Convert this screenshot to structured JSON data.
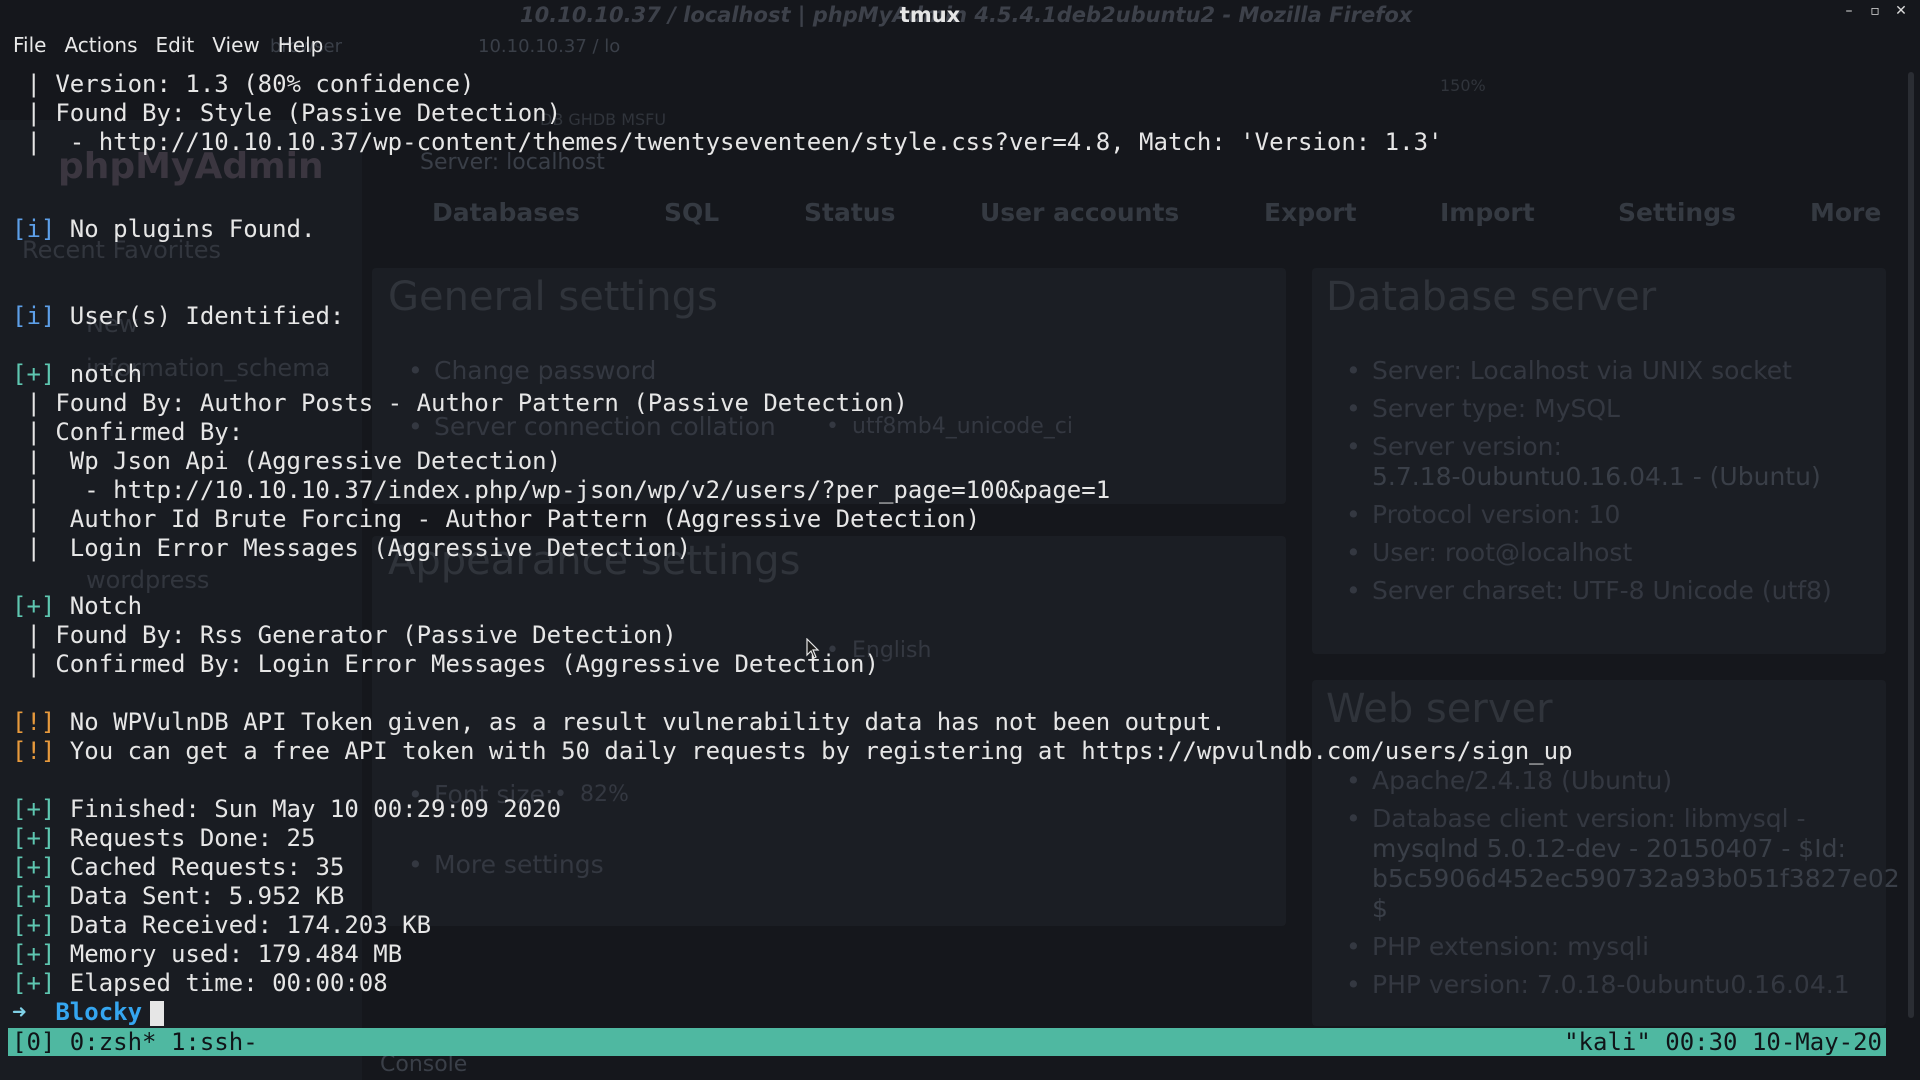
{
  "window": {
    "title": "tmux",
    "background_title": "10.10.10.37 / localhost | phpMyAdmin 4.5.4.1deb2ubuntu2 - Mozilla Firefox"
  },
  "menu": [
    "File",
    "Actions",
    "Edit",
    "View",
    "Help"
  ],
  "background": {
    "tabs": [
      "browser",
      "10.10.10.37 / lo"
    ],
    "bookmarks": "DB  GHDB  MSFU",
    "zoom": "150%",
    "logo": "phpMyAdmin",
    "breadcrumb": "Server: localhost",
    "nav_tabs": [
      "Databases",
      "SQL",
      "Status",
      "User accounts",
      "Export",
      "Import",
      "Settings",
      "More"
    ],
    "sidebar": [
      "Recent  Favorites",
      "New",
      "information_schema",
      "wordpress"
    ],
    "general_settings": "General settings",
    "change_password": "Change password",
    "server_collation_label": "Server connection collation",
    "server_collation_value": "utf8mb4_unicode_ci",
    "appearance_settings": "Appearance settings",
    "language_value": "English",
    "font_size_label": "Font size:",
    "font_size_value": "82%",
    "more_settings": "More settings",
    "database_server_title": "Database server",
    "database_server": [
      "Server: Localhost via UNIX socket",
      "Server type: MySQL",
      "Server version:",
      "5.7.18-0ubuntu0.16.04.1 - (Ubuntu)",
      "Protocol version: 10",
      "User: root@localhost",
      "Server charset: UTF-8 Unicode (utf8)"
    ],
    "web_server_title": "Web server",
    "web_server": [
      "Apache/2.4.18 (Ubuntu)",
      "Database client version: libmysql -",
      "mysqlnd 5.0.12-dev - 20150407 - $Id:",
      "b5c5906d452ec590732a93b051f3827e02",
      "$",
      "PHP extension: mysqli",
      "PHP version: 7.0.18-0ubuntu0.16.04.1"
    ],
    "console": "Console"
  },
  "terminal": {
    "lines": [
      {
        "prefix": "",
        "text": " | Version: 1.3 (80% confidence)"
      },
      {
        "prefix": "",
        "text": " | Found By: Style (Passive Detection)"
      },
      {
        "prefix": "",
        "text": " |  - http://10.10.10.37/wp-content/themes/twentyseventeen/style.css?ver=4.8, Match: 'Version: 1.3'"
      },
      {
        "prefix": "",
        "text": ""
      },
      {
        "prefix": "",
        "text": ""
      },
      {
        "prefix": "[i]",
        "kind": "info",
        "text": " No plugins Found."
      },
      {
        "prefix": "",
        "text": ""
      },
      {
        "prefix": "",
        "text": ""
      },
      {
        "prefix": "[i]",
        "kind": "info",
        "text": " User(s) Identified:"
      },
      {
        "prefix": "",
        "text": ""
      },
      {
        "prefix": "[+]",
        "kind": "plus",
        "text": " notch"
      },
      {
        "prefix": "",
        "text": " | Found By: Author Posts - Author Pattern (Passive Detection)"
      },
      {
        "prefix": "",
        "text": " | Confirmed By:"
      },
      {
        "prefix": "",
        "text": " |  Wp Json Api (Aggressive Detection)"
      },
      {
        "prefix": "",
        "text": " |   - http://10.10.10.37/index.php/wp-json/wp/v2/users/?per_page=100&page=1"
      },
      {
        "prefix": "",
        "text": " |  Author Id Brute Forcing - Author Pattern (Aggressive Detection)"
      },
      {
        "prefix": "",
        "text": " |  Login Error Messages (Aggressive Detection)"
      },
      {
        "prefix": "",
        "text": ""
      },
      {
        "prefix": "[+]",
        "kind": "plus",
        "text": " Notch"
      },
      {
        "prefix": "",
        "text": " | Found By: Rss Generator (Passive Detection)"
      },
      {
        "prefix": "",
        "text": " | Confirmed By: Login Error Messages (Aggressive Detection)"
      },
      {
        "prefix": "",
        "text": ""
      },
      {
        "prefix": "[!]",
        "kind": "warn",
        "text": " No WPVulnDB API Token given, as a result vulnerability data has not been output."
      },
      {
        "prefix": "[!]",
        "kind": "warn",
        "text": " You can get a free API token with 50 daily requests by registering at https://wpvulndb.com/users/sign_up"
      },
      {
        "prefix": "",
        "text": ""
      },
      {
        "prefix": "[+]",
        "kind": "plus",
        "text": " Finished: Sun May 10 00:29:09 2020"
      },
      {
        "prefix": "[+]",
        "kind": "plus",
        "text": " Requests Done: 25"
      },
      {
        "prefix": "[+]",
        "kind": "plus",
        "text": " Cached Requests: 35"
      },
      {
        "prefix": "[+]",
        "kind": "plus",
        "text": " Data Sent: 5.952 KB"
      },
      {
        "prefix": "[+]",
        "kind": "plus",
        "text": " Data Received: 174.203 KB"
      },
      {
        "prefix": "[+]",
        "kind": "plus",
        "text": " Memory used: 179.484 MB"
      },
      {
        "prefix": "[+]",
        "kind": "plus",
        "text": " Elapsed time: 00:00:08"
      }
    ],
    "prompt": {
      "arrow": "➜",
      "dir": "Blocky"
    }
  },
  "statusbar": {
    "left": "[0] 0:zsh* 1:ssh-",
    "right": "\"kali\" 00:30 10-May-20"
  }
}
